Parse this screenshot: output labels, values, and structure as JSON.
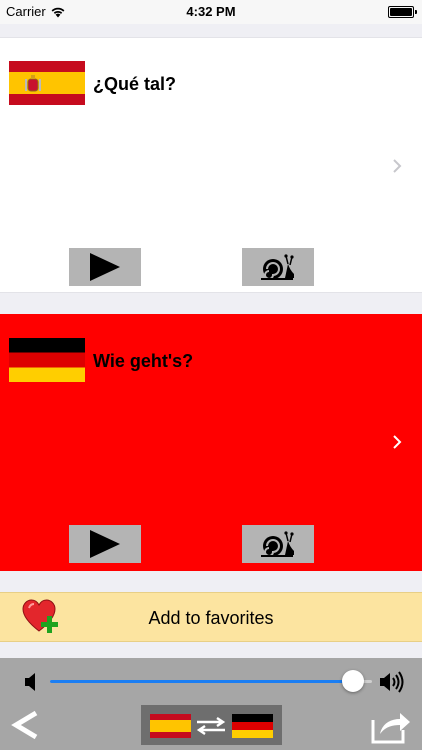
{
  "status_bar": {
    "carrier": "Carrier",
    "time": "4:32 PM",
    "icons": [
      "wifi-icon",
      "battery-icon"
    ]
  },
  "source_card": {
    "language_flag": "spain-flag",
    "phrase": "¿Qué tal?",
    "background_color": "#ffffff",
    "buttons": [
      "play-icon",
      "snail-icon"
    ]
  },
  "target_card": {
    "language_flag": "germany-flag",
    "phrase": "Wie geht's?",
    "background_color": "#ff0000",
    "buttons": [
      "play-icon",
      "snail-icon"
    ]
  },
  "favorites": {
    "label": "Add to favorites",
    "icon": "heart-plus-icon",
    "background_color": "#fce4a0"
  },
  "toolbar": {
    "volume_level": 0.94,
    "slider_color": "#1b7ef3",
    "back_label": "<",
    "swap_icons": [
      "spain-flag",
      "swap-arrows-icon",
      "germany-flag"
    ],
    "share_icon": "share-icon"
  }
}
